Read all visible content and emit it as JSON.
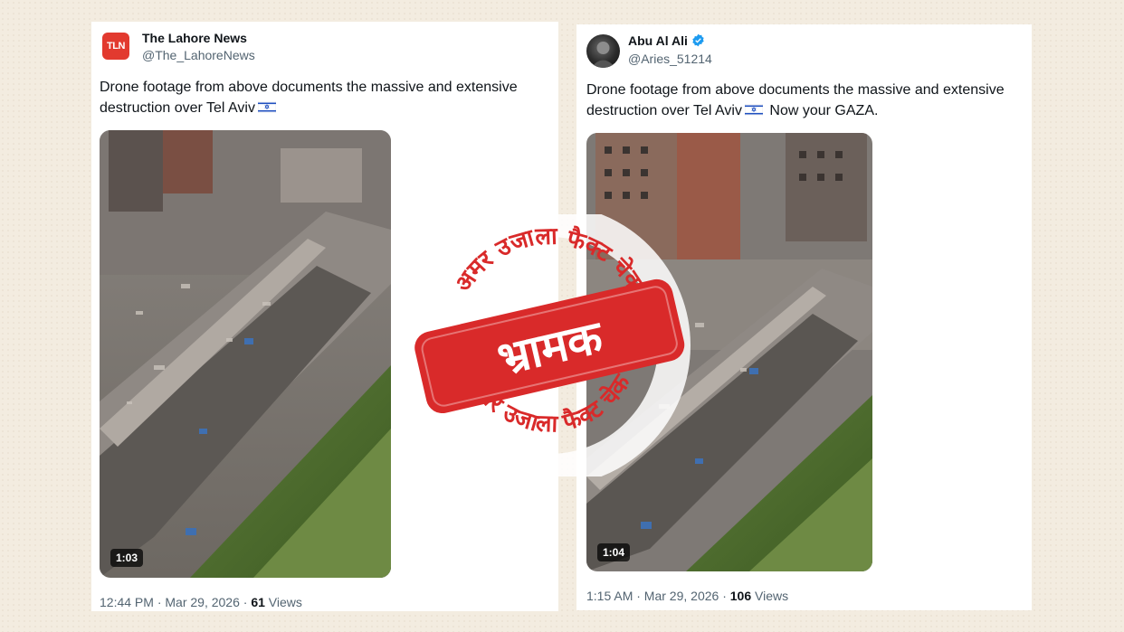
{
  "tweets": [
    {
      "name": "The Lahore News",
      "handle": "@The_LahoreNews",
      "avatar_text": "TLN",
      "text_line1": "Drone footage from above documents the massive and extensive",
      "text_line2": "destruction over Tel Aviv",
      "text_suffix": "",
      "flag_icon": "israel-flag-icon",
      "duration": "1:03",
      "time": "12:44 PM · Mar 29, 2026 · ",
      "views_count": "61",
      "views_label": " Views"
    },
    {
      "name": "Abu Al Ali",
      "handle": "@Aries_51214",
      "verified": true,
      "text_line1": "Drone footage from above documents the massive and extensive",
      "text_line2": "destruction over Tel Aviv",
      "text_suffix": " Now your GAZA.",
      "flag_icon": "israel-flag-icon",
      "duration": "1:04",
      "time": "1:15 AM · Mar 29, 2026 · ",
      "views_count": "106",
      "views_label": " Views"
    }
  ],
  "stamp": {
    "ring_text_top": "अमर उजाला फैक्ट चेक",
    "ring_text_bottom": "अमर उजाला फैक्ट चेक",
    "verdict": "भ्रामक",
    "color": "#d92a2a"
  },
  "colors": {
    "page_bg": "#f3ece0",
    "card_bg": "#ffffff",
    "verified_blue": "#1d9bf0",
    "logo_red": "#e23a2f"
  }
}
